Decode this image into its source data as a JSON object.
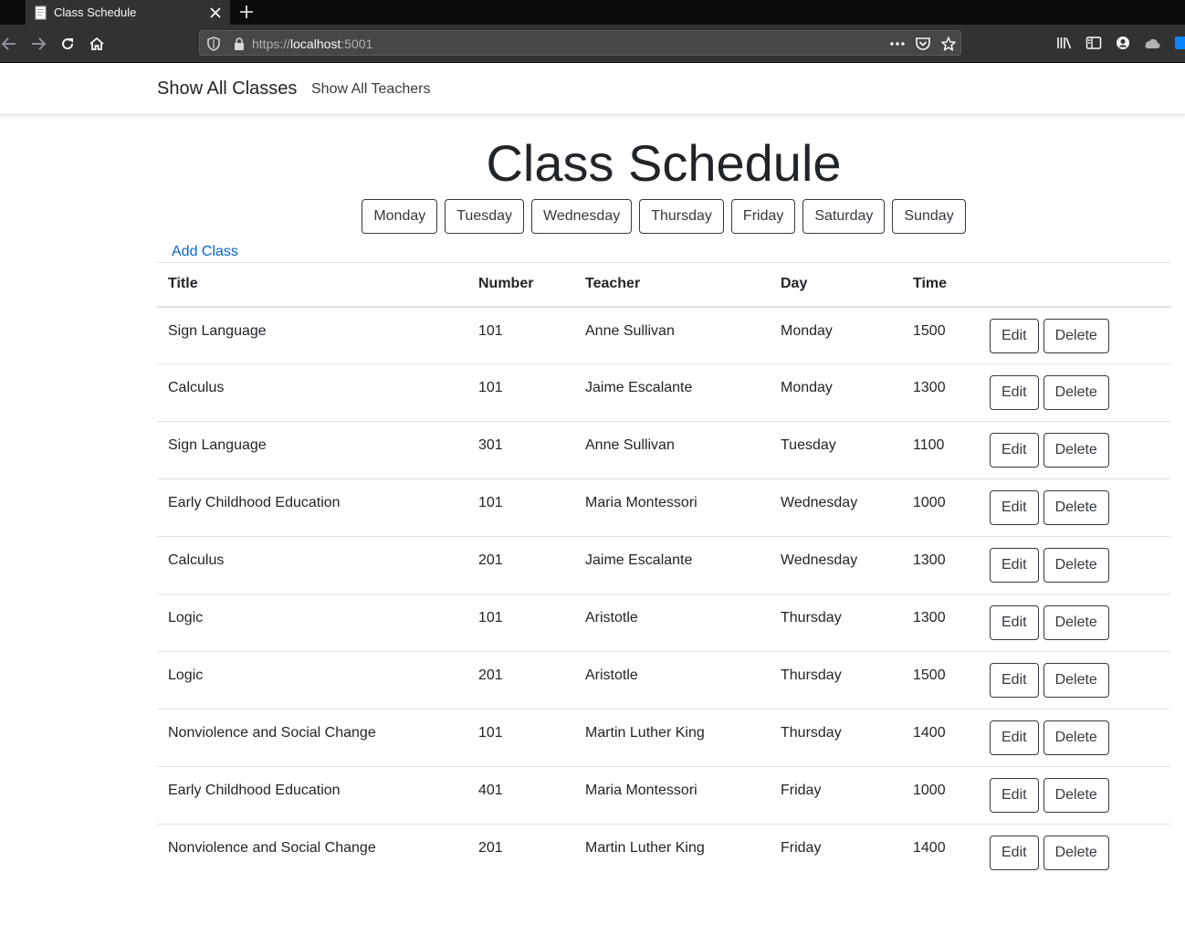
{
  "browser": {
    "tab_title": "Class Schedule",
    "url_scheme": "https://",
    "url_host": "localhost",
    "url_port": ":5001",
    "theme": {
      "chrome_bg": "#323234",
      "tabbar_bg": "#0c0c0d"
    }
  },
  "site_nav": {
    "brand": "Show All Classes",
    "teachers_link": "Show All Teachers"
  },
  "page": {
    "title": "Class Schedule",
    "add_class": "Add Class",
    "link_color": "#0366d6"
  },
  "days": [
    "Monday",
    "Tuesday",
    "Wednesday",
    "Thursday",
    "Friday",
    "Saturday",
    "Sunday"
  ],
  "table": {
    "headers": {
      "title": "Title",
      "number": "Number",
      "teacher": "Teacher",
      "day": "Day",
      "time": "Time"
    },
    "edit_label": "Edit",
    "delete_label": "Delete",
    "rows": [
      {
        "title": "Sign Language",
        "number": "101",
        "teacher": "Anne Sullivan",
        "day": "Monday",
        "time": "1500"
      },
      {
        "title": "Calculus",
        "number": "101",
        "teacher": "Jaime Escalante",
        "day": "Monday",
        "time": "1300"
      },
      {
        "title": "Sign Language",
        "number": "301",
        "teacher": "Anne Sullivan",
        "day": "Tuesday",
        "time": "1100"
      },
      {
        "title": "Early Childhood Education",
        "number": "101",
        "teacher": "Maria Montessori",
        "day": "Wednesday",
        "time": "1000"
      },
      {
        "title": "Calculus",
        "number": "201",
        "teacher": "Jaime Escalante",
        "day": "Wednesday",
        "time": "1300"
      },
      {
        "title": "Logic",
        "number": "101",
        "teacher": "Aristotle",
        "day": "Thursday",
        "time": "1300"
      },
      {
        "title": "Logic",
        "number": "201",
        "teacher": "Aristotle",
        "day": "Thursday",
        "time": "1500"
      },
      {
        "title": "Nonviolence and Social Change",
        "number": "101",
        "teacher": "Martin Luther King",
        "day": "Thursday",
        "time": "1400"
      },
      {
        "title": "Early Childhood Education",
        "number": "401",
        "teacher": "Maria Montessori",
        "day": "Friday",
        "time": "1000"
      },
      {
        "title": "Nonviolence and Social Change",
        "number": "201",
        "teacher": "Martin Luther King",
        "day": "Friday",
        "time": "1400"
      }
    ]
  }
}
